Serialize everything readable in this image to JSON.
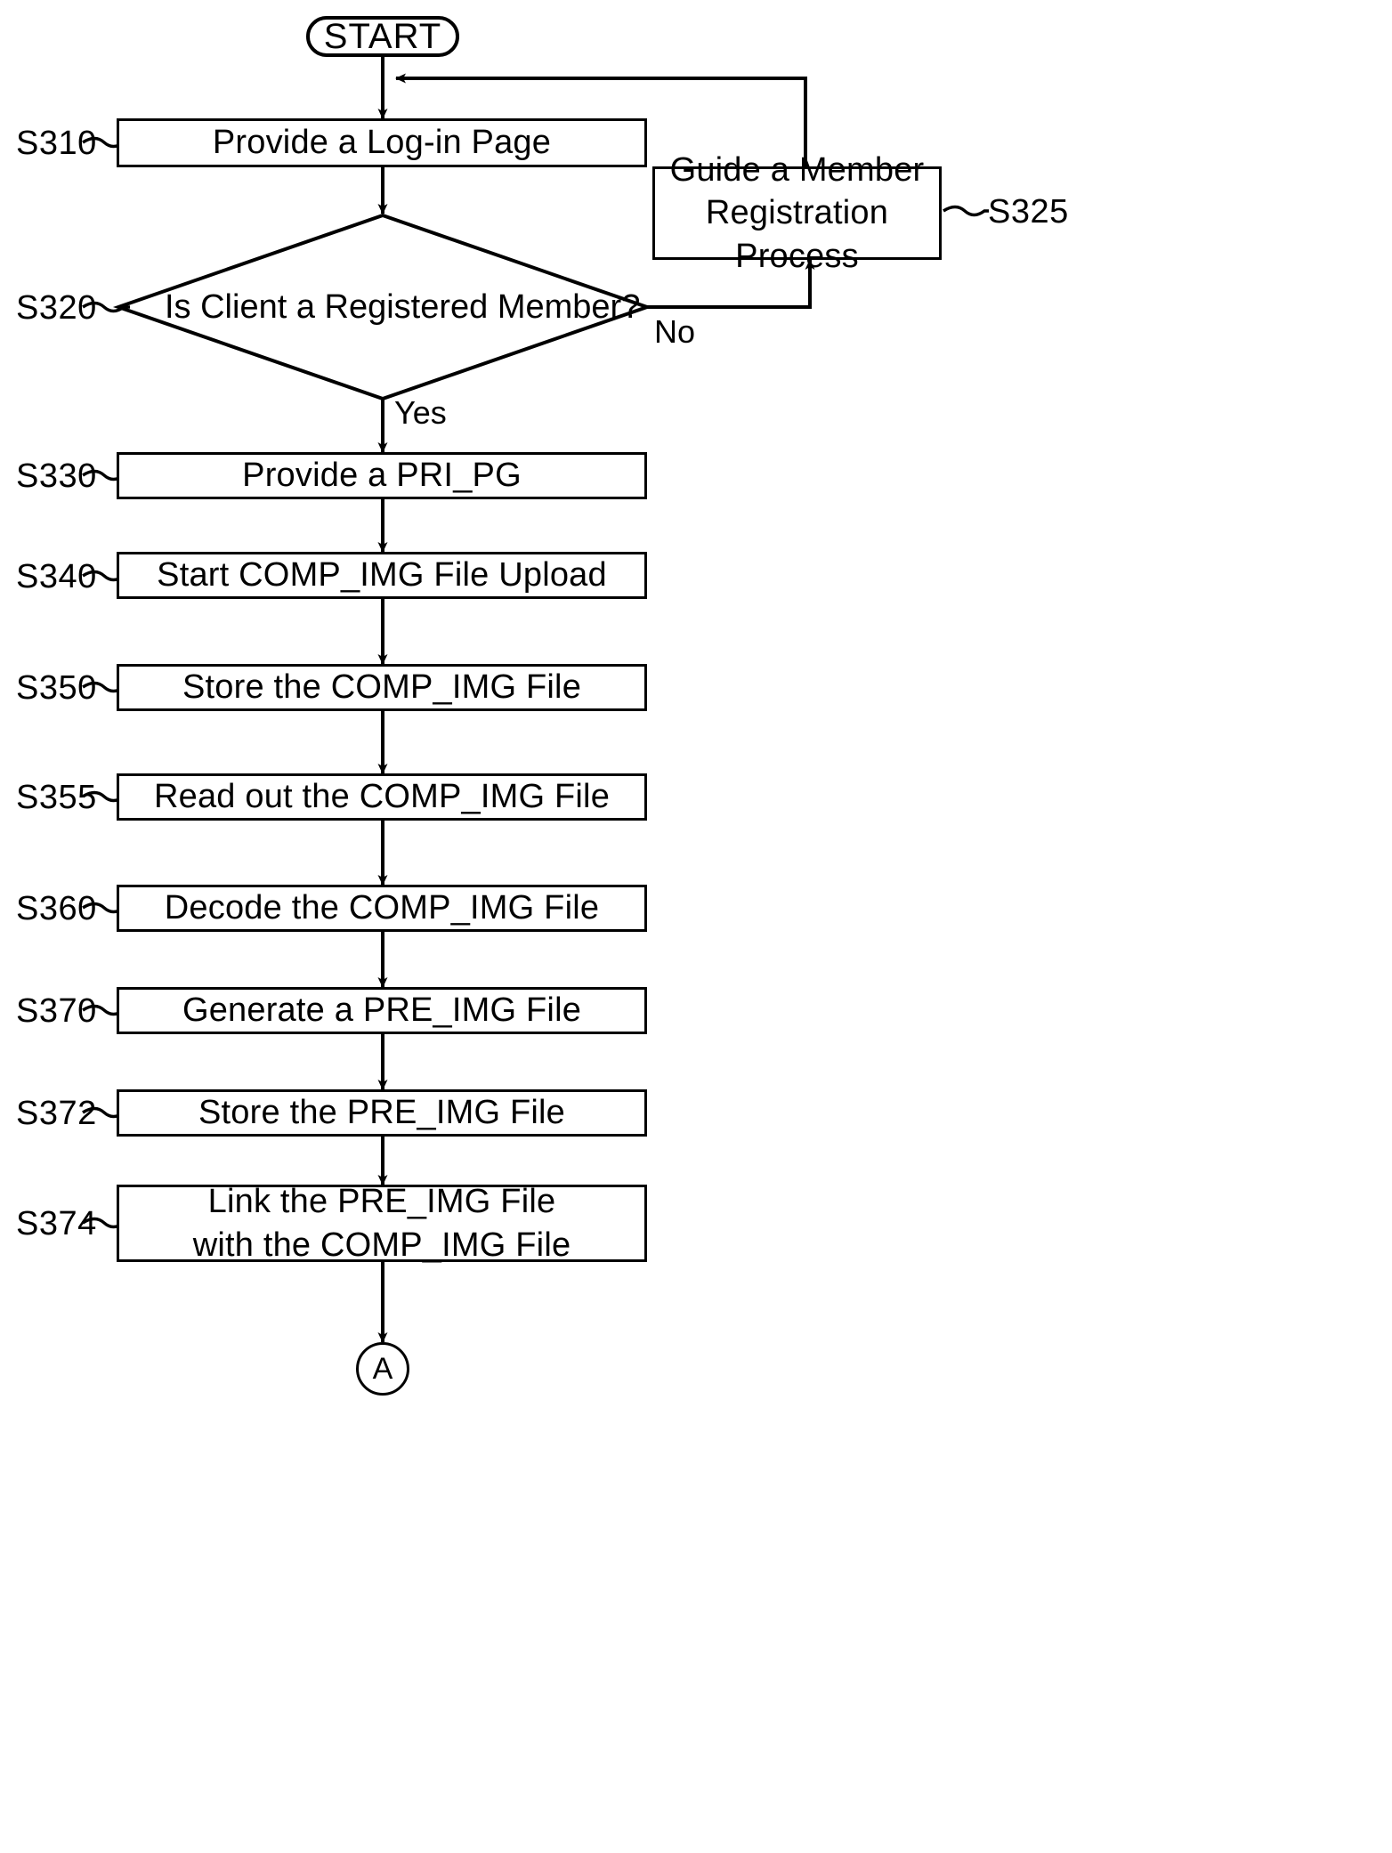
{
  "figure": {
    "type": "flowchart",
    "orientation": "vertical",
    "start_terminal": "START",
    "end_connector": "A"
  },
  "nodes": {
    "start": {
      "text": "START",
      "shape": "terminal"
    },
    "s310": {
      "step": "S310",
      "text": "Provide a Log-in Page",
      "shape": "process"
    },
    "s320": {
      "step": "S320",
      "text": "Is Client a Registered Member?",
      "shape": "decision"
    },
    "s325": {
      "step": "S325",
      "line1": "Guide a Member",
      "line2": "Registration Process",
      "shape": "process"
    },
    "s330": {
      "step": "S330",
      "text": "Provide a PRI_PG",
      "shape": "process"
    },
    "s340": {
      "step": "S340",
      "text": "Start COMP_IMG File Upload",
      "shape": "process"
    },
    "s350": {
      "step": "S350",
      "text": "Store the COMP_IMG File",
      "shape": "process"
    },
    "s355": {
      "step": "S355",
      "text": "Read out the COMP_IMG File",
      "shape": "process"
    },
    "s360": {
      "step": "S360",
      "text": "Decode the COMP_IMG File",
      "shape": "process"
    },
    "s370": {
      "step": "S370",
      "text": "Generate a PRE_IMG File",
      "shape": "process"
    },
    "s372": {
      "step": "S372",
      "text": "Store the PRE_IMG File",
      "shape": "process"
    },
    "s374": {
      "step": "S374",
      "line1": "Link the PRE_IMG File",
      "line2": "with the COMP_IMG File",
      "shape": "process"
    },
    "connector_a": {
      "text": "A",
      "shape": "connector"
    }
  },
  "branches": {
    "no_label": "No",
    "yes_label": "Yes"
  },
  "style": {
    "stroke": "#000000",
    "background": "#ffffff"
  }
}
